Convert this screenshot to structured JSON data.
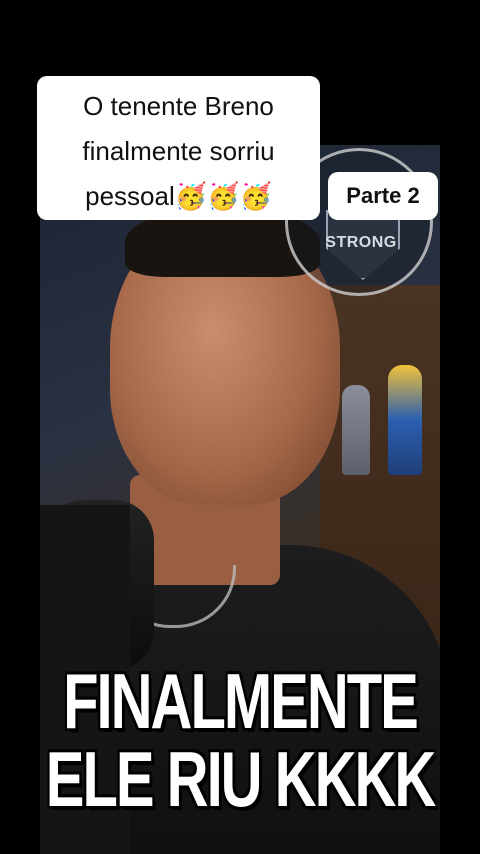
{
  "caption": {
    "line1": "O tenente Breno",
    "line2": "finalmente sorriu",
    "line3": "pessoal",
    "emojis": "🥳🥳🥳"
  },
  "badge": {
    "label": "Parte 2"
  },
  "logo": {
    "text": "STRONG"
  },
  "overlay_text": {
    "line1": "FINALMENTE",
    "line2": "ELE RIU KKKK"
  },
  "colors": {
    "background": "#000000",
    "caption_bg": "#ffffff",
    "overlay_text": "#ffffff"
  }
}
